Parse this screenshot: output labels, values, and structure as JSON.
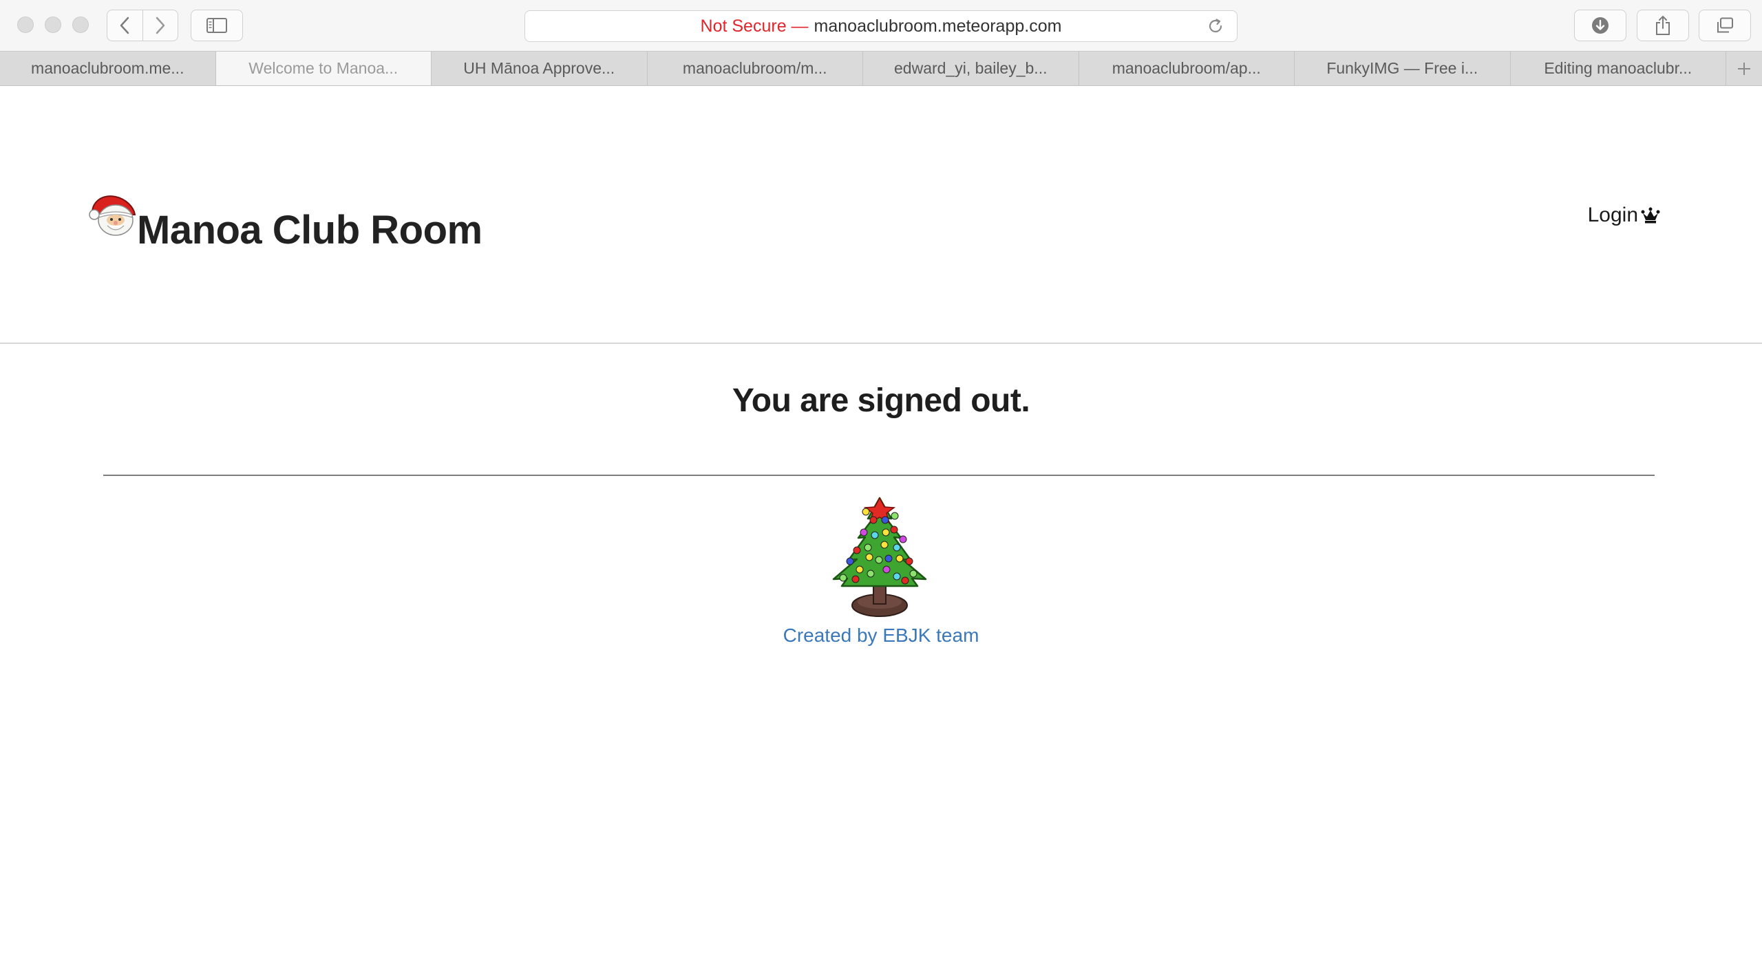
{
  "browser": {
    "address": {
      "security_label": "Not Secure —",
      "url": "manoaclubroom.meteorapp.com"
    },
    "tabs": [
      {
        "label": "manoaclubroom.me..."
      },
      {
        "label": "Welcome to Manoa..."
      },
      {
        "label": "UH Mānoa Approve..."
      },
      {
        "label": "manoaclubroom/m..."
      },
      {
        "label": "edward_yi, bailey_b..."
      },
      {
        "label": "manoaclubroom/ap..."
      },
      {
        "label": "FunkyIMG — Free i..."
      },
      {
        "label": "Editing manoaclubr..."
      }
    ],
    "active_tab_index": 1,
    "icons": {
      "back": "chevron-left-icon",
      "forward": "chevron-right-icon",
      "sidebar": "sidebar-icon",
      "reload": "reload-icon",
      "download": "download-icon",
      "share": "share-icon",
      "tabs_overview": "tabs-overview-icon",
      "new_tab": "plus-icon"
    }
  },
  "header": {
    "brand": "Manoa Club Room",
    "login_label": "Login",
    "logo_icon": "santa-icon",
    "login_icon": "crown-icon"
  },
  "main": {
    "message": "You are signed out.",
    "tree_icon": "christmas-tree-icon",
    "credit_link": "Created by EBJK team"
  },
  "colors": {
    "insecure": "#e0252b",
    "link": "#3a78b9",
    "text": "#1e1e1e"
  }
}
